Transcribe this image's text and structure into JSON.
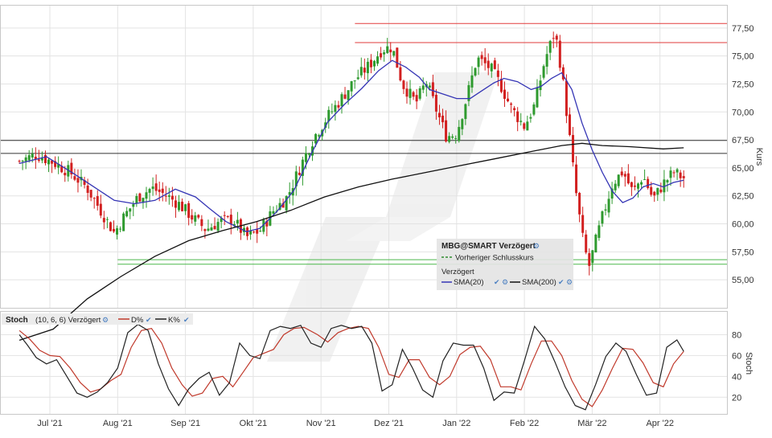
{
  "chart_data": [
    {
      "type": "candlestick",
      "title": "",
      "instrument": "MBG@SMART Verzögert",
      "ylabel": "Kurs",
      "ylim": [
        52.5,
        79.5
      ],
      "y_ticks": [
        55,
        57.5,
        60,
        62.5,
        65,
        67.5,
        70,
        72.5,
        75,
        77.5
      ],
      "y_tick_labels": [
        "55,00",
        "57,50",
        "60,00",
        "62,50",
        "65,00",
        "67,50",
        "70,00",
        "72,50",
        "75,00",
        "77,50"
      ],
      "x_tick_labels": [
        "Jul '21",
        "Aug '21",
        "Sep '21",
        "Okt '21",
        "Nov '21",
        "Dez '21",
        "Jan '22",
        "Feb '22",
        "Mär '22",
        "Apr '22"
      ],
      "grid": true,
      "legend": {
        "title": "MBG@SMART Verzögert",
        "previous_close_label": "Vorheriger Schlusskurs",
        "section_label": "Verzögert",
        "entries": [
          {
            "name": "SMA(20)",
            "color": "#3535b5"
          },
          {
            "name": "SMA(200)",
            "color": "#111111"
          }
        ]
      },
      "horizontal_lines": [
        {
          "y": 77.9,
          "color": "#e23b3b",
          "from_month": 4.95
        },
        {
          "y": 76.2,
          "color": "#e23b3b",
          "from_month": 4.95
        },
        {
          "y": 67.45,
          "color": "#333333",
          "from_month": 0
        },
        {
          "y": 66.3,
          "color": "#333333",
          "from_month": 0
        },
        {
          "y": 56.8,
          "color": "#4cb84c",
          "from_month": 1.45
        },
        {
          "y": 56.4,
          "color": "#4cb84c",
          "from_month": 1.45
        }
      ],
      "close_path": [
        [
          0.0,
          65.6
        ],
        [
          0.25,
          66.2
        ],
        [
          0.5,
          65.5
        ],
        [
          0.75,
          64.6
        ],
        [
          1.0,
          63.2
        ],
        [
          1.2,
          61.2
        ],
        [
          1.4,
          59.2
        ],
        [
          1.55,
          60.7
        ],
        [
          1.75,
          62.4
        ],
        [
          1.95,
          63.2
        ],
        [
          2.15,
          62.6
        ],
        [
          2.35,
          61.8
        ],
        [
          2.55,
          60.6
        ],
        [
          2.75,
          59.5
        ],
        [
          2.95,
          60.2
        ],
        [
          3.15,
          60.4
        ],
        [
          3.35,
          58.8
        ],
        [
          3.55,
          59.4
        ],
        [
          3.75,
          61.2
        ],
        [
          3.95,
          62.4
        ],
        [
          4.15,
          65.2
        ],
        [
          4.35,
          67.8
        ],
        [
          4.55,
          69.6
        ],
        [
          4.75,
          71.2
        ],
        [
          4.95,
          72.9
        ],
        [
          5.15,
          74.1
        ],
        [
          5.35,
          75.6
        ],
        [
          5.5,
          75.8
        ],
        [
          5.65,
          72.5
        ],
        [
          5.85,
          70.8
        ],
        [
          6.0,
          72.7
        ],
        [
          6.15,
          70.2
        ],
        [
          6.3,
          67.8
        ],
        [
          6.45,
          68.1
        ],
        [
          6.6,
          71.3
        ],
        [
          6.75,
          74.8
        ],
        [
          6.95,
          73.9
        ],
        [
          7.1,
          72.4
        ],
        [
          7.25,
          70.4
        ],
        [
          7.45,
          68.7
        ],
        [
          7.6,
          70.6
        ],
        [
          7.75,
          74.6
        ],
        [
          7.9,
          77.2
        ],
        [
          8.0,
          73.6
        ],
        [
          8.1,
          68.6
        ],
        [
          8.2,
          63.3
        ],
        [
          8.3,
          59.0
        ],
        [
          8.4,
          56.1
        ],
        [
          8.5,
          58.4
        ],
        [
          8.6,
          60.6
        ],
        [
          8.75,
          63.6
        ],
        [
          8.9,
          64.7
        ],
        [
          9.05,
          62.8
        ],
        [
          9.2,
          64.3
        ],
        [
          9.35,
          62.2
        ],
        [
          9.5,
          63.6
        ],
        [
          9.65,
          64.6
        ],
        [
          9.8,
          64.1
        ]
      ],
      "series": [
        {
          "name": "SMA(20)",
          "color": "#3535b5",
          "points": [
            [
              0.0,
              65.4
            ],
            [
              0.4,
              66.0
            ],
            [
              0.8,
              64.5
            ],
            [
              1.1,
              63.3
            ],
            [
              1.4,
              62.1
            ],
            [
              1.7,
              61.8
            ],
            [
              2.0,
              62.1
            ],
            [
              2.3,
              63.1
            ],
            [
              2.6,
              62.4
            ],
            [
              2.8,
              61.4
            ],
            [
              3.05,
              60.2
            ],
            [
              3.35,
              59.3
            ],
            [
              3.55,
              59.6
            ],
            [
              3.8,
              61.1
            ],
            [
              4.05,
              63.0
            ],
            [
              4.3,
              66.2
            ],
            [
              4.55,
              69.1
            ],
            [
              4.8,
              70.7
            ],
            [
              5.05,
              72.1
            ],
            [
              5.3,
              73.7
            ],
            [
              5.5,
              74.6
            ],
            [
              5.7,
              74.0
            ],
            [
              5.9,
              73.1
            ],
            [
              6.05,
              72.0
            ],
            [
              6.25,
              71.6
            ],
            [
              6.45,
              71.2
            ],
            [
              6.65,
              71.2
            ],
            [
              6.8,
              71.8
            ],
            [
              7.0,
              72.6
            ],
            [
              7.15,
              73.0
            ],
            [
              7.35,
              72.7
            ],
            [
              7.55,
              72.0
            ],
            [
              7.7,
              72.3
            ],
            [
              7.85,
              73.0
            ],
            [
              8.0,
              73.5
            ],
            [
              8.15,
              72.0
            ],
            [
              8.3,
              69.0
            ],
            [
              8.45,
              66.6
            ],
            [
              8.6,
              64.6
            ],
            [
              8.75,
              62.9
            ],
            [
              8.9,
              61.9
            ],
            [
              9.05,
              62.3
            ],
            [
              9.2,
              63.3
            ],
            [
              9.35,
              63.6
            ],
            [
              9.5,
              63.3
            ],
            [
              9.65,
              63.7
            ],
            [
              9.8,
              63.9
            ]
          ]
        },
        {
          "name": "SMA(200)",
          "color": "#111111",
          "points": [
            [
              0.0,
              49.6
            ],
            [
              0.5,
              50.6
            ],
            [
              1.0,
              53.3
            ],
            [
              1.5,
              55.3
            ],
            [
              2.0,
              57.1
            ],
            [
              2.5,
              58.5
            ],
            [
              3.0,
              59.4
            ],
            [
              3.5,
              60.2
            ],
            [
              4.0,
              61.2
            ],
            [
              4.5,
              62.4
            ],
            [
              5.0,
              63.3
            ],
            [
              5.5,
              64.0
            ],
            [
              6.0,
              64.6
            ],
            [
              6.5,
              65.2
            ],
            [
              7.0,
              65.8
            ],
            [
              7.5,
              66.4
            ],
            [
              8.0,
              67.0
            ],
            [
              8.3,
              67.2
            ],
            [
              8.6,
              67.0
            ],
            [
              9.0,
              66.9
            ],
            [
              9.5,
              66.7
            ],
            [
              9.8,
              66.8
            ]
          ]
        }
      ]
    },
    {
      "type": "line",
      "title": "Stoch",
      "params_label": "(10, 6, 6) Verzögert",
      "ylabel": "Stoch",
      "ylim": [
        4,
        102
      ],
      "y_ticks": [
        20,
        40,
        60,
        80
      ],
      "y_tick_labels": [
        "20",
        "40",
        "60",
        "80"
      ],
      "grid": true,
      "legend_placement": "top-left",
      "series": [
        {
          "name": "D%",
          "color": "#c0392b",
          "points": [
            [
              0.0,
              84.0
            ],
            [
              0.15,
              76.0
            ],
            [
              0.3,
              65.0
            ],
            [
              0.45,
              60.0
            ],
            [
              0.6,
              59.0
            ],
            [
              0.75,
              48.0
            ],
            [
              0.9,
              34.0
            ],
            [
              1.05,
              25.0
            ],
            [
              1.2,
              28.0
            ],
            [
              1.35,
              36.0
            ],
            [
              1.5,
              42.0
            ],
            [
              1.65,
              68.0
            ],
            [
              1.8,
              84.0
            ],
            [
              1.95,
              86.0
            ],
            [
              2.1,
              72.0
            ],
            [
              2.25,
              48.0
            ],
            [
              2.4,
              32.0
            ],
            [
              2.55,
              21.0
            ],
            [
              2.7,
              24.0
            ],
            [
              2.85,
              38.0
            ],
            [
              3.0,
              40.0
            ],
            [
              3.15,
              30.0
            ],
            [
              3.3,
              44.0
            ],
            [
              3.45,
              58.0
            ],
            [
              3.6,
              62.0
            ],
            [
              3.75,
              66.0
            ],
            [
              3.9,
              80.0
            ],
            [
              4.05,
              86.0
            ],
            [
              4.2,
              87.0
            ],
            [
              4.4,
              80.0
            ],
            [
              4.55,
              73.0
            ],
            [
              4.7,
              82.0
            ],
            [
              4.85,
              86.0
            ],
            [
              5.0,
              88.0
            ],
            [
              5.15,
              86.0
            ],
            [
              5.3,
              68.0
            ],
            [
              5.45,
              42.0
            ],
            [
              5.6,
              39.0
            ],
            [
              5.75,
              56.0
            ],
            [
              5.9,
              56.0
            ],
            [
              6.05,
              39.0
            ],
            [
              6.2,
              32.0
            ],
            [
              6.35,
              40.0
            ],
            [
              6.5,
              61.0
            ],
            [
              6.65,
              68.0
            ],
            [
              6.8,
              69.0
            ],
            [
              6.95,
              56.0
            ],
            [
              7.1,
              30.0
            ],
            [
              7.25,
              30.0
            ],
            [
              7.4,
              27.0
            ],
            [
              7.55,
              52.0
            ],
            [
              7.7,
              74.0
            ],
            [
              7.85,
              74.0
            ],
            [
              8.0,
              60.0
            ],
            [
              8.15,
              36.0
            ],
            [
              8.3,
              18.0
            ],
            [
              8.45,
              11.0
            ],
            [
              8.6,
              27.0
            ],
            [
              8.75,
              48.0
            ],
            [
              8.9,
              67.0
            ],
            [
              9.05,
              66.0
            ],
            [
              9.2,
              53.0
            ],
            [
              9.35,
              34.0
            ],
            [
              9.5,
              30.0
            ],
            [
              9.65,
              52.0
            ],
            [
              9.8,
              64.0
            ]
          ]
        },
        {
          "name": "K%",
          "color": "#222222",
          "points": [
            [
              0.0,
              80.0
            ],
            [
              0.12,
              70.0
            ],
            [
              0.25,
              58.0
            ],
            [
              0.4,
              52.0
            ],
            [
              0.55,
              56.0
            ],
            [
              0.7,
              40.0
            ],
            [
              0.85,
              24.0
            ],
            [
              1.0,
              20.0
            ],
            [
              1.15,
              25.0
            ],
            [
              1.3,
              34.0
            ],
            [
              1.45,
              48.0
            ],
            [
              1.6,
              82.0
            ],
            [
              1.75,
              90.0
            ],
            [
              1.9,
              84.0
            ],
            [
              2.05,
              52.0
            ],
            [
              2.2,
              28.0
            ],
            [
              2.35,
              12.0
            ],
            [
              2.5,
              28.0
            ],
            [
              2.65,
              38.0
            ],
            [
              2.8,
              44.0
            ],
            [
              2.95,
              22.0
            ],
            [
              3.1,
              34.0
            ],
            [
              3.25,
              72.0
            ],
            [
              3.4,
              60.0
            ],
            [
              3.55,
              57.0
            ],
            [
              3.7,
              84.0
            ],
            [
              3.85,
              88.0
            ],
            [
              4.0,
              86.0
            ],
            [
              4.15,
              89.0
            ],
            [
              4.3,
              72.0
            ],
            [
              4.45,
              68.0
            ],
            [
              4.6,
              86.0
            ],
            [
              4.75,
              89.0
            ],
            [
              4.9,
              86.0
            ],
            [
              5.05,
              88.0
            ],
            [
              5.2,
              72.0
            ],
            [
              5.35,
              26.0
            ],
            [
              5.5,
              32.0
            ],
            [
              5.65,
              66.0
            ],
            [
              5.8,
              48.0
            ],
            [
              5.95,
              27.0
            ],
            [
              6.1,
              20.0
            ],
            [
              6.25,
              55.0
            ],
            [
              6.4,
              72.0
            ],
            [
              6.55,
              70.0
            ],
            [
              6.7,
              70.0
            ],
            [
              6.85,
              48.0
            ],
            [
              7.0,
              17.0
            ],
            [
              7.15,
              25.0
            ],
            [
              7.3,
              24.0
            ],
            [
              7.45,
              55.0
            ],
            [
              7.6,
              88.0
            ],
            [
              7.75,
              76.0
            ],
            [
              7.9,
              54.0
            ],
            [
              8.05,
              30.0
            ],
            [
              8.2,
              12.0
            ],
            [
              8.35,
              8.0
            ],
            [
              8.5,
              32.0
            ],
            [
              8.65,
              59.0
            ],
            [
              8.8,
              72.0
            ],
            [
              8.95,
              64.0
            ],
            [
              9.1,
              42.0
            ],
            [
              9.25,
              22.0
            ],
            [
              9.4,
              24.0
            ],
            [
              9.55,
              68.0
            ],
            [
              9.7,
              75.0
            ],
            [
              9.8,
              64.0
            ]
          ]
        }
      ]
    }
  ]
}
